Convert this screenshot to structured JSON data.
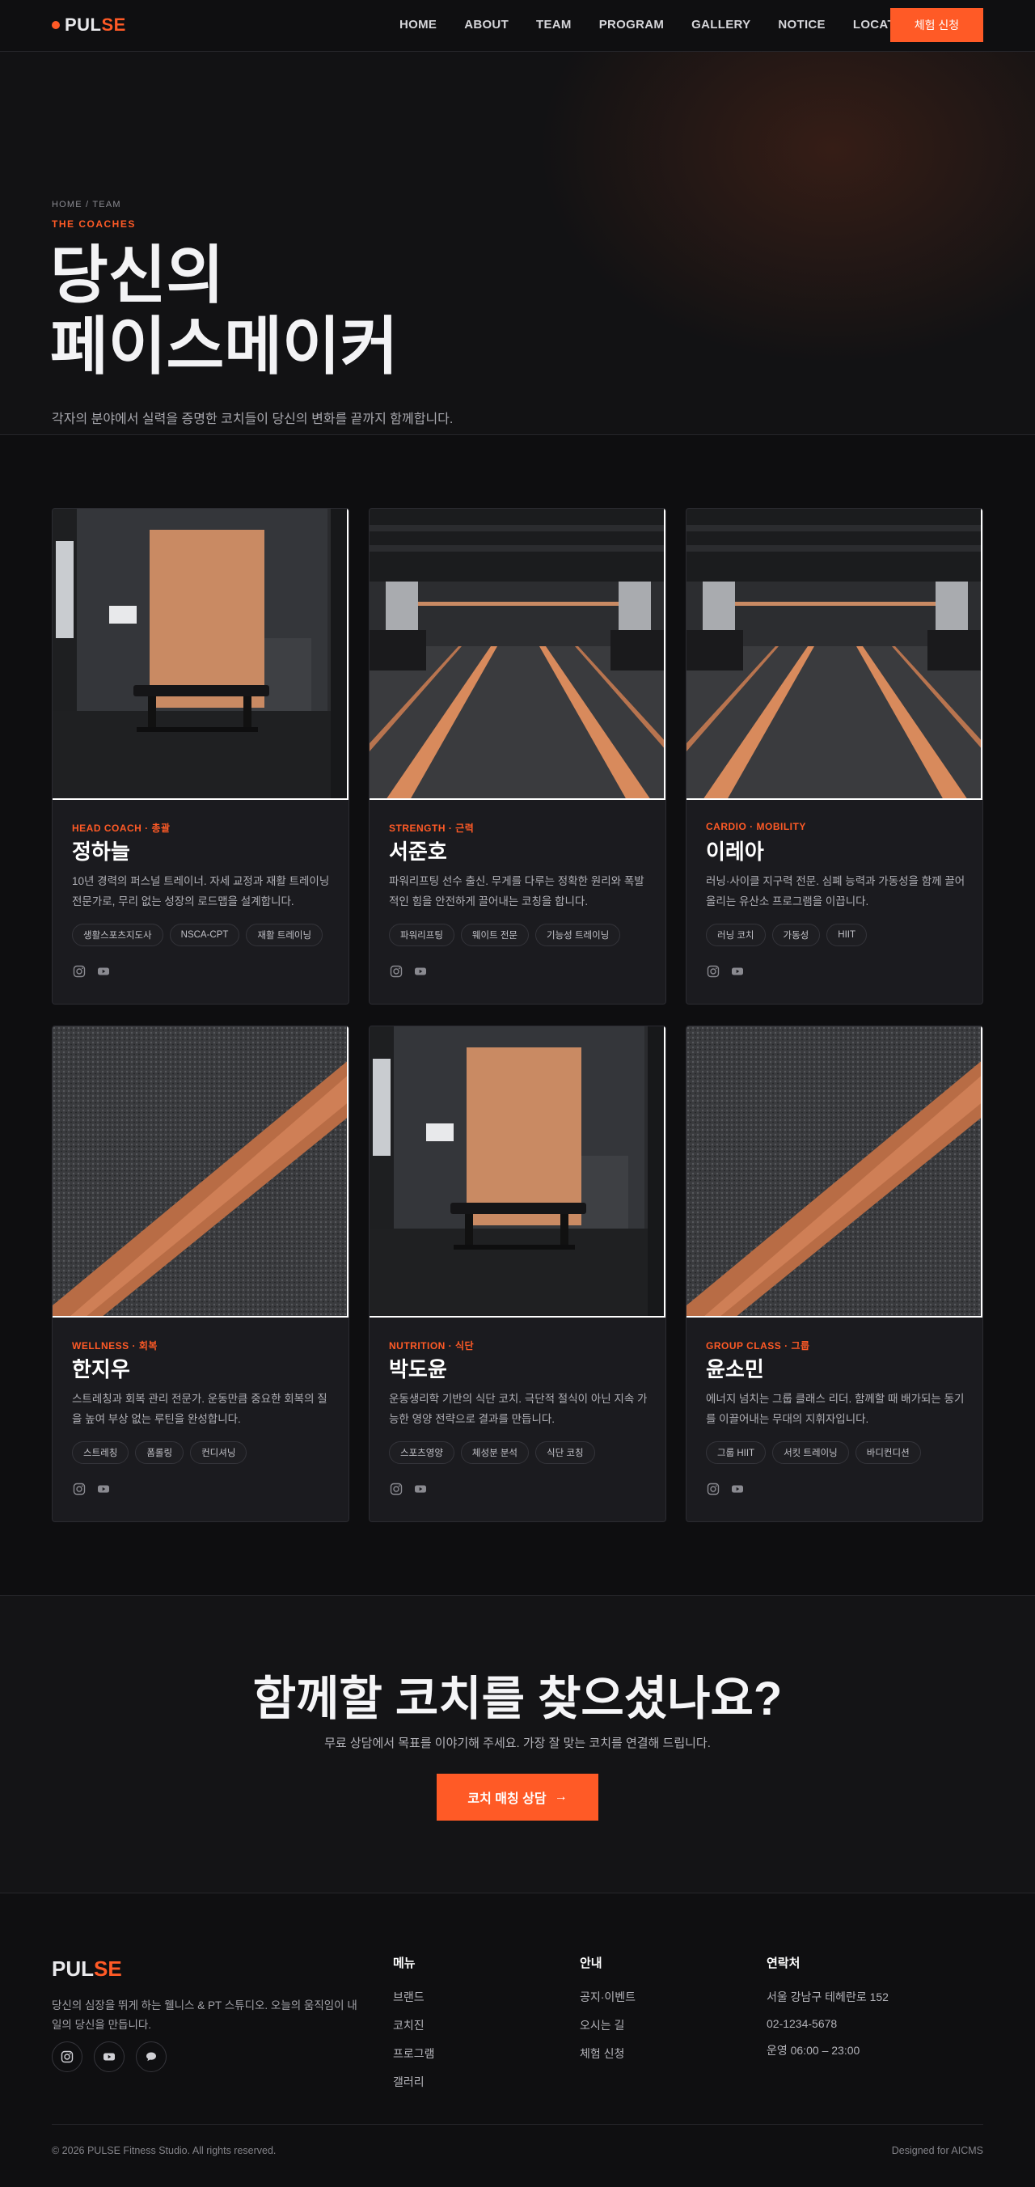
{
  "header": {
    "logo_main": "PUL",
    "logo_accent": "SE",
    "nav": [
      "HOME",
      "ABOUT",
      "TEAM",
      "PROGRAM",
      "GALLERY",
      "NOTICE",
      "LOCATION"
    ],
    "cta": "체험 신청"
  },
  "hero": {
    "breadcrumb": "HOME / TEAM",
    "kicker": "THE COACHES",
    "title_line1": "당신의",
    "title_line2": "페이스메이커",
    "subtitle": "각자의 분야에서 실력을 증명한 코치들이 당신의 변화를 끝까지 함께합니다."
  },
  "coaches": [
    {
      "role": "HEAD COACH · 총괄",
      "name": "정하늘",
      "desc": "10년 경력의 퍼스널 트레이너. 자세 교정과 재활 트레이닝 전문가로, 무리 없는 성장의 로드맵을 설계합니다.",
      "tags": [
        "생활스포츠지도사",
        "NSCA-CPT",
        "재활 트레이닝"
      ],
      "photo": "bench"
    },
    {
      "role": "STRENGTH · 근력",
      "name": "서준호",
      "desc": "파워리프팅 선수 출신. 무게를 다루는 정확한 원리와 폭발적인 힘을 안전하게 끌어내는 코칭을 합니다.",
      "tags": [
        "파워리프팅",
        "웨이트 전문",
        "기능성 트레이닝"
      ],
      "photo": "gym"
    },
    {
      "role": "CARDIO · MOBILITY",
      "name": "이레아",
      "desc": "러닝·사이클 지구력 전문. 심폐 능력과 가동성을 함께 끌어올리는 유산소 프로그램을 이끕니다.",
      "tags": [
        "러닝 코치",
        "가동성",
        "HIIT"
      ],
      "photo": "gym"
    },
    {
      "role": "WELLNESS · 회복",
      "name": "한지우",
      "desc": "스트레칭과 회복 관리 전문가. 운동만큼 중요한 회복의 질을 높여 부상 없는 루틴을 완성합니다.",
      "tags": [
        "스트레칭",
        "폼롤링",
        "컨디셔닝"
      ],
      "photo": "floor"
    },
    {
      "role": "NUTRITION · 식단",
      "name": "박도윤",
      "desc": "운동생리학 기반의 식단 코치. 극단적 절식이 아닌 지속 가능한 영양 전략으로 결과를 만듭니다.",
      "tags": [
        "스포츠영양",
        "체성분 분석",
        "식단 코칭"
      ],
      "photo": "bench"
    },
    {
      "role": "GROUP CLASS · 그룹",
      "name": "윤소민",
      "desc": "에너지 넘치는 그룹 클래스 리더. 함께할 때 배가되는 동기를 이끌어내는 무대의 지휘자입니다.",
      "tags": [
        "그룹 HIIT",
        "서킷 트레이닝",
        "바디컨디션"
      ],
      "photo": "floor"
    }
  ],
  "cta_band": {
    "title": "함께할 코치를 찾으셨나요?",
    "text": "무료 상담에서 목표를 이야기해 주세요. 가장 잘 맞는 코치를 연결해 드립니다.",
    "button": "코치 매칭 상담",
    "button_arrow": "→"
  },
  "footer": {
    "logo_main": "PUL",
    "logo_accent": "SE",
    "desc": "당신의 심장을 뛰게 하는 웰니스 & PT 스튜디오. 오늘의 움직임이 내일의 당신을 만듭니다.",
    "menu_title": "메뉴",
    "menu": [
      "브랜드",
      "코치진",
      "프로그램",
      "갤러리"
    ],
    "info_title": "안내",
    "info": [
      "공지·이벤트",
      "오시는 길",
      "체험 신청"
    ],
    "contact_title": "연락처",
    "contact": [
      "서울 강남구 테헤란로 152",
      "02-1234-5678",
      "운영 06:00 – 23:00"
    ],
    "copyright": "© 2026 PULSE Fitness Studio. All rights reserved.",
    "credit": "Designed for AICMS"
  },
  "colors": {
    "accent": "#ff5a26",
    "bg": "#0e0e10",
    "card": "#1b1b1f"
  }
}
